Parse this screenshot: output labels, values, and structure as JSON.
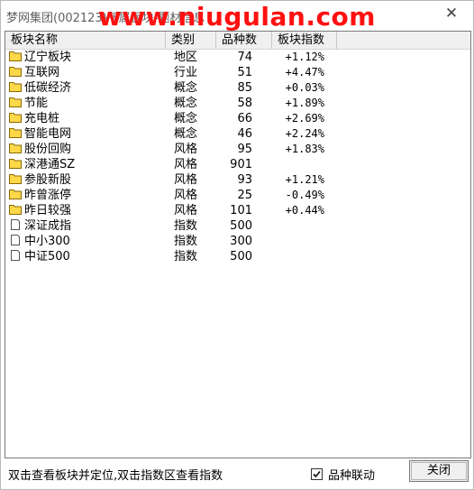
{
  "window": {
    "title": "梦网集团(002123)所属板块-题材信息",
    "watermark": "www.niugulan.com"
  },
  "table": {
    "columns": [
      "板块名称",
      "类别",
      "品种数",
      "板块指数"
    ],
    "rows": [
      {
        "name": "辽宁板块",
        "category": "地区",
        "count": "74",
        "index": "+1.12%",
        "icon": "folder-icon"
      },
      {
        "name": "互联网",
        "category": "行业",
        "count": "51",
        "index": "+4.47%",
        "icon": "folder-icon"
      },
      {
        "name": "低碳经济",
        "category": "概念",
        "count": "85",
        "index": "+0.03%",
        "icon": "folder-icon"
      },
      {
        "name": "节能",
        "category": "概念",
        "count": "58",
        "index": "+1.89%",
        "icon": "folder-icon"
      },
      {
        "name": "充电桩",
        "category": "概念",
        "count": "66",
        "index": "+2.69%",
        "icon": "folder-icon"
      },
      {
        "name": "智能电网",
        "category": "概念",
        "count": "46",
        "index": "+2.24%",
        "icon": "folder-icon"
      },
      {
        "name": "股份回购",
        "category": "风格",
        "count": "95",
        "index": "+1.83%",
        "icon": "folder-icon"
      },
      {
        "name": "深港通SZ",
        "category": "风格",
        "count": "901",
        "index": "",
        "icon": "folder-icon"
      },
      {
        "name": "参股新股",
        "category": "风格",
        "count": "93",
        "index": "+1.21%",
        "icon": "folder-icon"
      },
      {
        "name": "昨曾涨停",
        "category": "风格",
        "count": "25",
        "index": "-0.49%",
        "icon": "folder-icon"
      },
      {
        "name": "昨日较强",
        "category": "风格",
        "count": "101",
        "index": "+0.44%",
        "icon": "folder-icon"
      },
      {
        "name": "深证成指",
        "category": "指数",
        "count": "500",
        "index": "",
        "icon": "document-icon"
      },
      {
        "name": "中小300",
        "category": "指数",
        "count": "300",
        "index": "",
        "icon": "document-icon"
      },
      {
        "name": "中证500",
        "category": "指数",
        "count": "500",
        "index": "",
        "icon": "document-icon"
      }
    ]
  },
  "status": {
    "hint": "双击查看板块并定位,双击指数区查看指数",
    "linkage_label": "品种联动",
    "linkage_checked": true,
    "close_label": "关闭"
  },
  "colors": {
    "watermark": "#ff1010",
    "folder_fill": "#ffd84a",
    "folder_stroke": "#8a6a00"
  }
}
